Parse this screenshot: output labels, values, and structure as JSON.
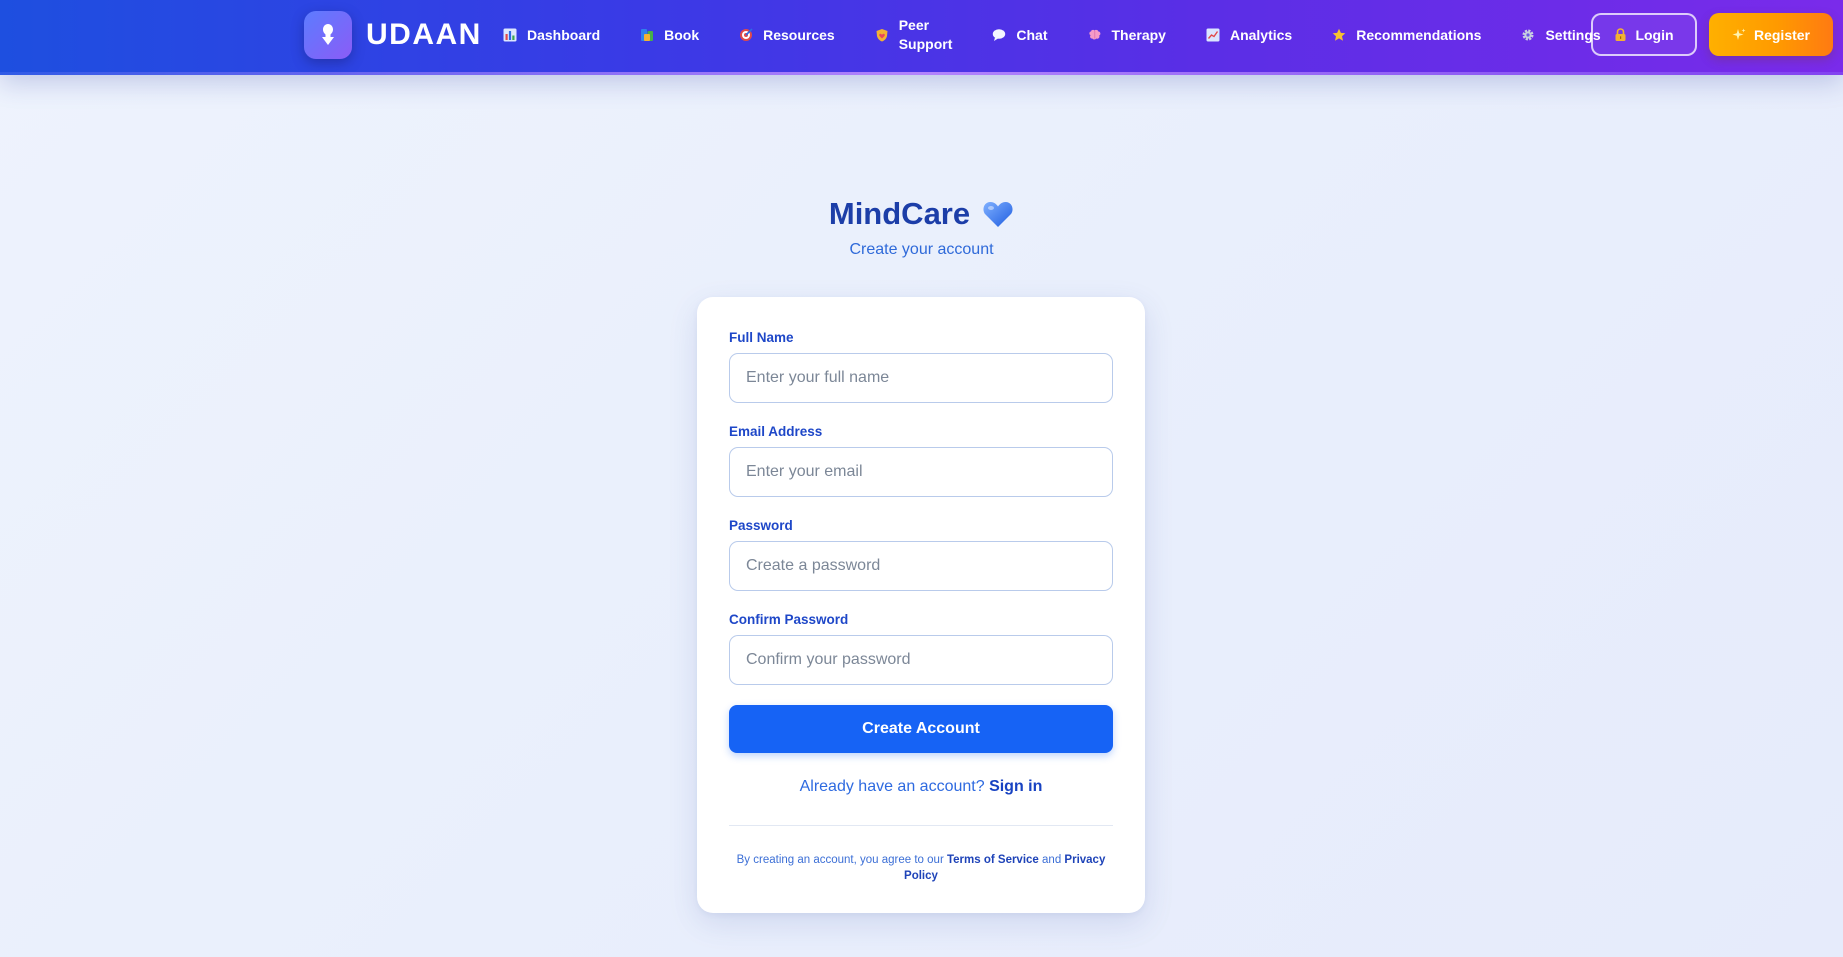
{
  "nav": {
    "brand": "UDAAN",
    "items": [
      {
        "label": "Dashboard",
        "icon": "bar-chart-icon"
      },
      {
        "label": "Book",
        "icon": "books-icon"
      },
      {
        "label": "Resources",
        "icon": "target-icon"
      },
      {
        "label": "Peer Support",
        "label_line1": "Peer",
        "label_line2": "Support",
        "icon": "shield-heart-icon"
      },
      {
        "label": "Chat",
        "icon": "speech-bubble-icon"
      },
      {
        "label": "Therapy",
        "icon": "brain-icon"
      },
      {
        "label": "Analytics",
        "icon": "trend-chart-icon"
      },
      {
        "label": "Recommendations",
        "icon": "star-icon"
      },
      {
        "label": "Settings",
        "icon": "gear-icon"
      }
    ],
    "login_label": "Login",
    "register_label": "Register"
  },
  "header": {
    "title": "MindCare",
    "subtitle": "Create your account"
  },
  "form": {
    "full_name": {
      "label": "Full Name",
      "placeholder": "Enter your full name",
      "value": ""
    },
    "email": {
      "label": "Email Address",
      "placeholder": "Enter your email",
      "value": ""
    },
    "password": {
      "label": "Password",
      "placeholder": "Create a password",
      "value": ""
    },
    "confirm_password": {
      "label": "Confirm Password",
      "placeholder": "Confirm your password",
      "value": ""
    },
    "submit_label": "Create Account",
    "signin_prompt": "Already have an account?",
    "signin_link": "Sign in",
    "terms_prefix": "By creating an account, you agree to our",
    "terms_link": "Terms of Service",
    "terms_and": "and",
    "privacy_link": "Privacy Policy"
  },
  "colors": {
    "nav_start": "#1e4fe0",
    "nav_end": "#7a2bea",
    "primary": "#1663f5",
    "register_accent": "#ffa000",
    "title": "#1c3ea8"
  }
}
